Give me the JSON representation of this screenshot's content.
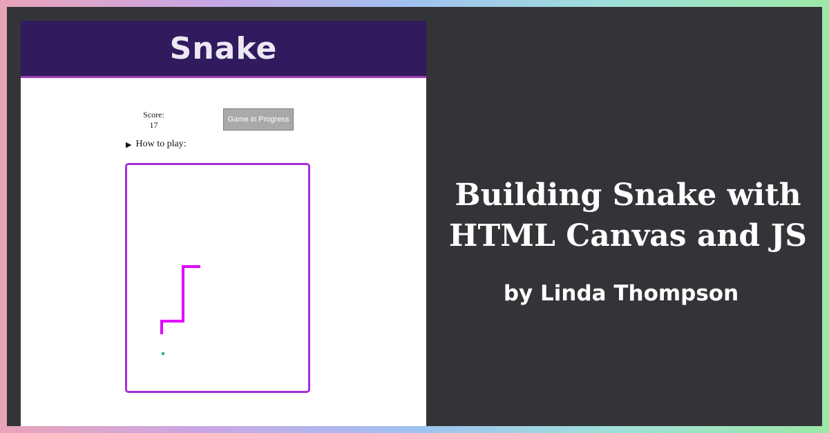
{
  "game": {
    "title": "Snake",
    "score_label": "Score:",
    "score_value": "17",
    "status_button": "Game in Progress",
    "howto_label": "How to play:",
    "colors": {
      "header_bg": "#311a5e",
      "board_border": "#a62fd6",
      "snake": "#e100ff",
      "food": "#3cb371"
    }
  },
  "headline": {
    "line1": "Building Snake with",
    "line2": "HTML Canvas and JS",
    "byline": "by Linda Thompson"
  },
  "icons": {
    "howto_toggle": "triangle-right-icon"
  }
}
